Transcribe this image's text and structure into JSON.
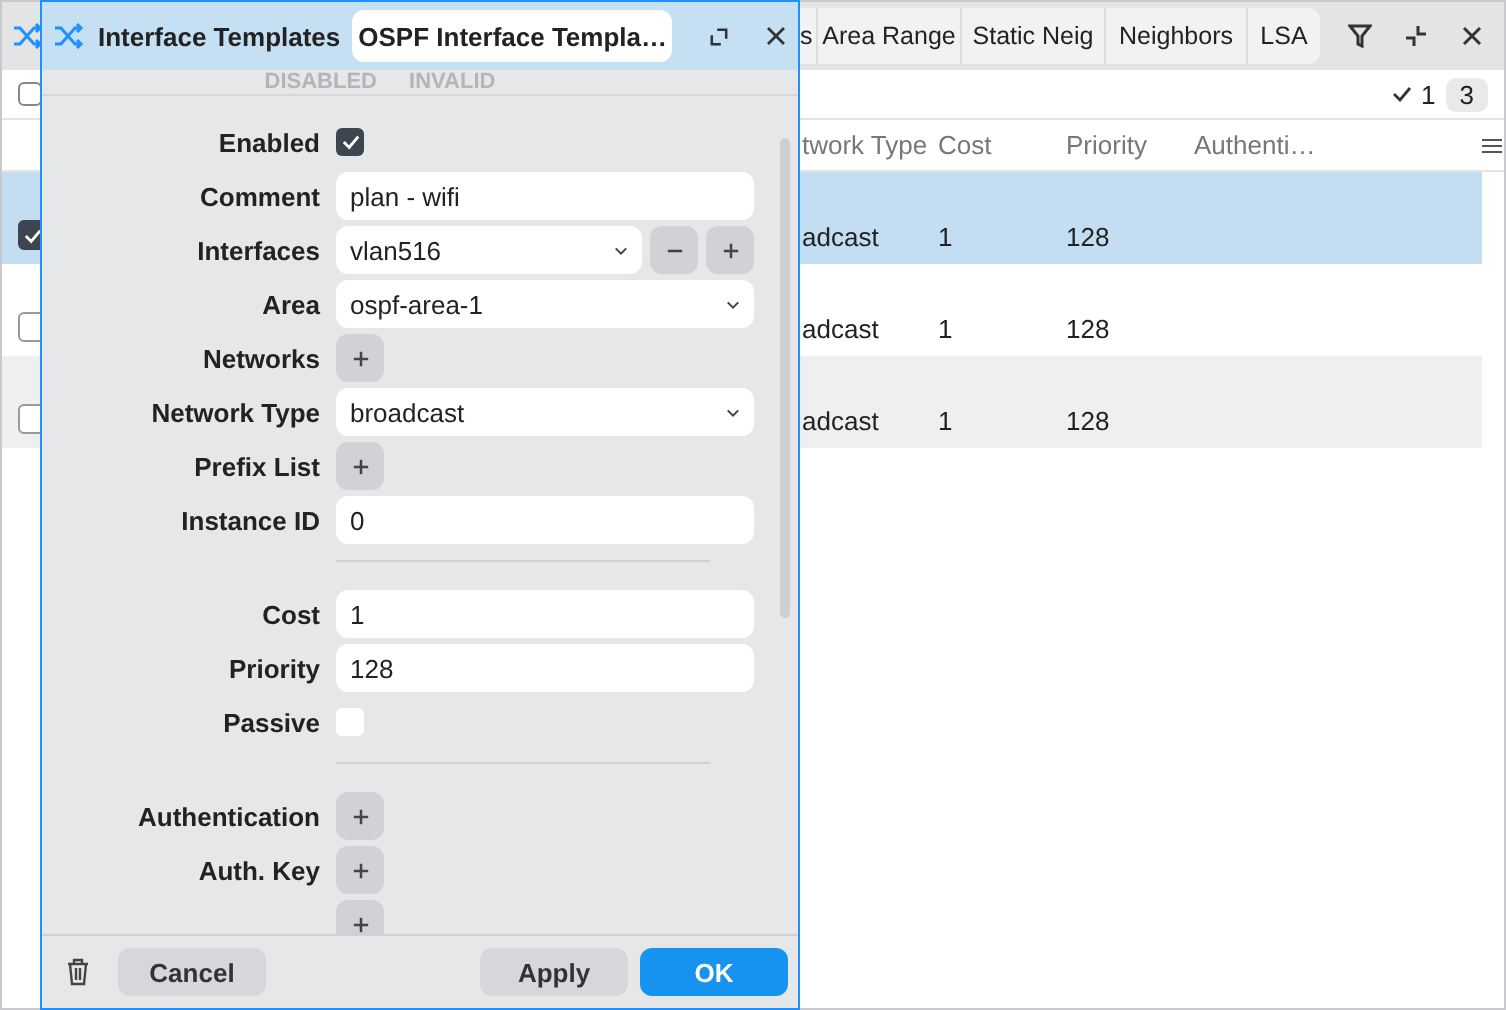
{
  "app": {
    "tabs": [
      {
        "label": "s",
        "selected": false
      },
      {
        "label": "Area Range",
        "selected": false
      },
      {
        "label": "Static Neig",
        "selected": false
      },
      {
        "label": "Neighbors",
        "selected": false
      },
      {
        "label": "LSA",
        "selected": false
      }
    ],
    "select_all": false,
    "selected_count": "1",
    "total_count": "3",
    "columns": [
      "twork Type",
      "Cost",
      "Priority",
      "Authenti…"
    ],
    "rows": [
      {
        "selected": true,
        "cells": [
          "adcast",
          "1",
          "128"
        ]
      },
      {
        "selected": false,
        "cells": [
          "adcast",
          "1",
          "128"
        ]
      },
      {
        "selected": false,
        "cells": [
          "adcast",
          "1",
          "128"
        ]
      }
    ]
  },
  "dialog": {
    "title": "Interface Templates",
    "name": "OSPF Interface Templa…",
    "flags": [
      "DISABLED",
      "INVALID"
    ],
    "fields": [
      {
        "kind": "checkbox",
        "label": "Enabled",
        "checked": true
      },
      {
        "kind": "text",
        "label": "Comment",
        "value": "plan - wifi"
      },
      {
        "kind": "multi",
        "label": "Interfaces",
        "value": "vlan516"
      },
      {
        "kind": "select",
        "label": "Area",
        "value": "ospf-area-1"
      },
      {
        "kind": "add",
        "label": "Networks"
      },
      {
        "kind": "select",
        "label": "Network Type",
        "value": "broadcast"
      },
      {
        "kind": "add",
        "label": "Prefix List"
      },
      {
        "kind": "text",
        "label": "Instance ID",
        "value": "0"
      },
      {
        "kind": "divider"
      },
      {
        "kind": "text",
        "label": "Cost",
        "value": "1"
      },
      {
        "kind": "text",
        "label": "Priority",
        "value": "128"
      },
      {
        "kind": "checkbox",
        "label": "Passive",
        "checked": false
      },
      {
        "kind": "divider"
      },
      {
        "kind": "add",
        "label": "Authentication"
      },
      {
        "kind": "add",
        "label": "Auth. Key"
      },
      {
        "kind": "add"
      }
    ],
    "buttons": {
      "cancel": "Cancel",
      "apply": "Apply",
      "ok": "OK"
    }
  }
}
